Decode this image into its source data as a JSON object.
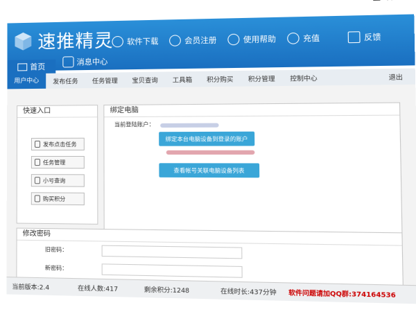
{
  "window": {
    "min": "▬",
    "close": "✕"
  },
  "app": {
    "title": "速推精灵"
  },
  "topnav": [
    {
      "label": "首页",
      "icon": "monitor-icon"
    },
    {
      "label": "消息中心",
      "icon": "message-icon"
    },
    {
      "label": "软件下载",
      "icon": "globe-icon"
    },
    {
      "label": "会员注册",
      "icon": "mouse-icon"
    },
    {
      "label": "使用帮助",
      "icon": "help-icon"
    },
    {
      "label": "充值",
      "icon": "arrow-icon"
    },
    {
      "label": "反馈",
      "icon": "mail-icon"
    }
  ],
  "subnav": [
    "用户中心",
    "发布任务",
    "任务管理",
    "宝贝查询",
    "工具箱",
    "积分购买",
    "积分管理",
    "控制中心",
    "退出"
  ],
  "quick": {
    "title": "快速入口",
    "buttons": [
      "发布点击任务",
      "任务管理",
      "小号查询",
      "购买积分"
    ]
  },
  "bind": {
    "title": "绑定电脑",
    "current_account_label": "当前登陆账户：",
    "btn_bind": "绑定本台电脑设备到登录的账户",
    "btn_view": "查看帐号关联电脑设备列表"
  },
  "password": {
    "title": "修改密码",
    "old_label": "旧密码：",
    "new_label": "新密码："
  },
  "status": {
    "version": "当前版本:2.4",
    "online_users": "在线人数:417",
    "remaining_points": "剩余积分:1248",
    "online_time": "在线时长:437分钟",
    "qq": "软件问题请加QQ群:374164536"
  },
  "colors": {
    "brand": "#1a6fc0",
    "accent": "#3aa6d8",
    "warning": "#cc0000"
  }
}
